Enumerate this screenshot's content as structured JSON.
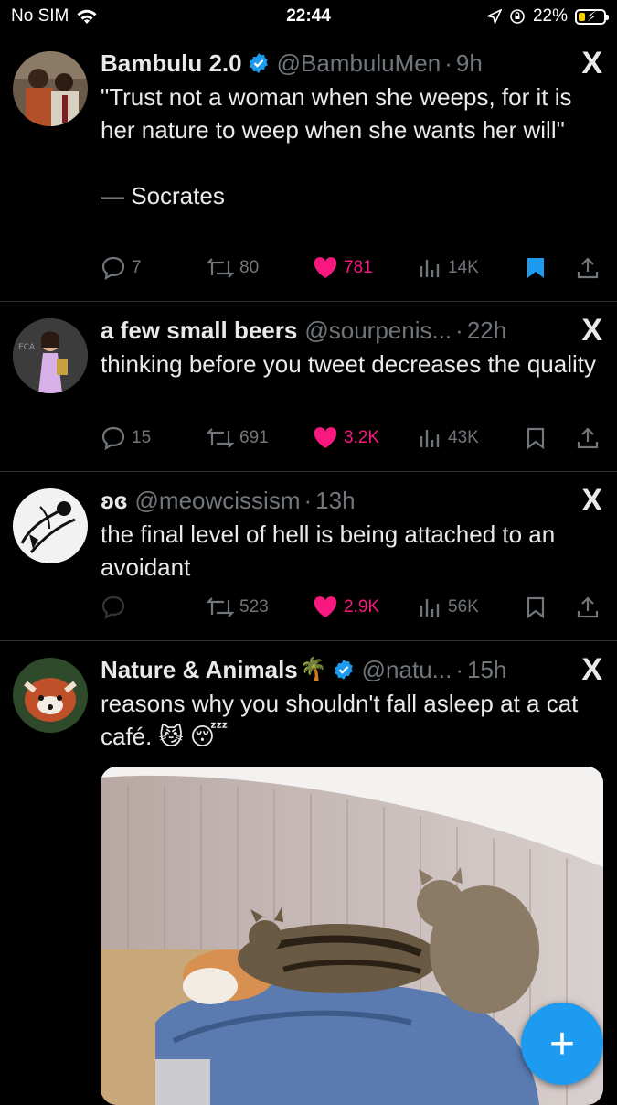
{
  "status_bar": {
    "carrier": "No SIM",
    "time": "22:44",
    "battery": "22%"
  },
  "colors": {
    "accent": "#1d9bf0",
    "like": "#f91880",
    "muted": "#71767b"
  },
  "tweets": [
    {
      "name": "Bambulu 2.0",
      "verified": true,
      "handle": "@BambuluMen",
      "time": "9h",
      "text": "\"Trust not a woman when she weeps, for it is her nature to weep when she wants her will\"\n\n— Socrates",
      "replies": "7",
      "retweets": "80",
      "likes": "781",
      "views": "14K",
      "bookmarked": true
    },
    {
      "name": "a few small beers",
      "verified": false,
      "handle": "@sourpenis...",
      "time": "22h",
      "text": "thinking before you tweet decreases the quality",
      "replies": "15",
      "retweets": "691",
      "likes": "3.2K",
      "views": "43K",
      "bookmarked": false
    },
    {
      "name": "ʚɞ",
      "verified": false,
      "handle": "@meowcissism",
      "time": "13h",
      "text": "the final level of hell is being attached to an avoidant",
      "replies": "",
      "retweets": "523",
      "likes": "2.9K",
      "views": "56K",
      "bookmarked": false
    },
    {
      "name": "Nature & Animals",
      "name_emoji": "🌴",
      "verified": true,
      "handle": "@natu...",
      "time": "15h",
      "text": "reasons why you shouldn't fall asleep at a cat café. 😼 😴",
      "media": "video-cats-on-sleeping-person"
    }
  ],
  "x_label": "X",
  "fab_label": "+"
}
